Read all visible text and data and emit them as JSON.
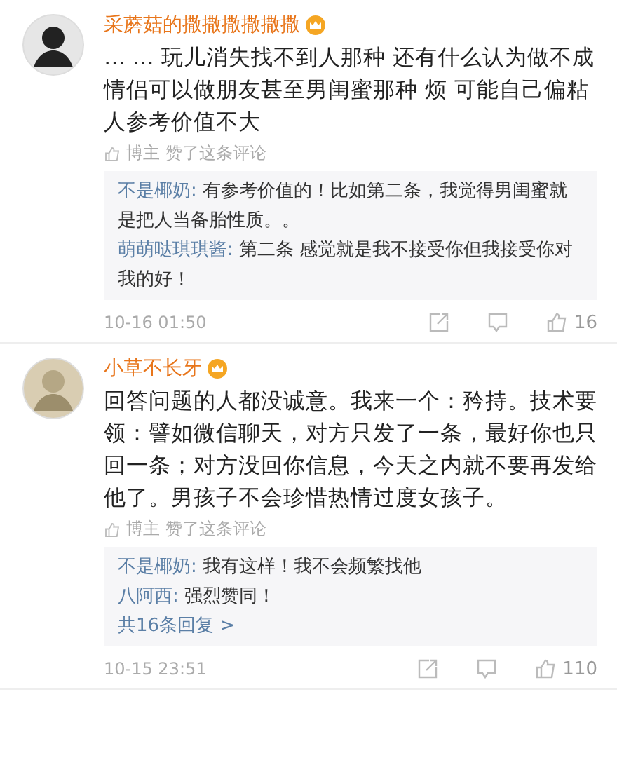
{
  "comments": [
    {
      "name": "采蘑菇的撒撒撒撒撒撒",
      "body": "… … 玩儿消失找不到人那种 还有什么认为做不成情侣可以做朋友甚至男闺蜜那种 烦 可能自己偏粘人参考价值不大",
      "liked_note": "博主 赞了这条评论",
      "replies": [
        {
          "author": "不是椰奶:",
          "text": "有参考价值的！比如第二条，我觉得男闺蜜就是把人当备胎性质。。"
        },
        {
          "author": "萌萌哒琪琪酱:",
          "text": "第二条  感觉就是我不接受你但我接受你对我的好！"
        }
      ],
      "time": "10-16 01:50",
      "likes": "16"
    },
    {
      "name": "小草不长牙",
      "body": "回答问题的人都没诚意。我来一个：矜持。技术要领：譬如微信聊天，对方只发了一条，最好你也只回一条；对方没回你信息，今天之内就不要再发给他了。男孩子不会珍惜热情过度女孩子。",
      "liked_note": "博主 赞了这条评论",
      "replies": [
        {
          "author": "不是椰奶:",
          "text": "我有这样！我不会频繁找他"
        },
        {
          "author": "八阿西:",
          "text": "强烈赞同！"
        }
      ],
      "more_replies": "共16条回复 >",
      "time": "10-15 23:51",
      "likes": "110"
    }
  ]
}
